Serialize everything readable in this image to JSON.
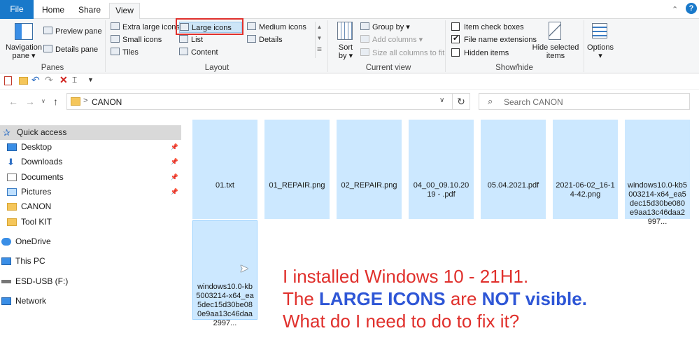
{
  "tabs": {
    "file": "File",
    "home": "Home",
    "share": "Share",
    "view": "View"
  },
  "panes": {
    "navigation_pane": "Navigation pane ▾",
    "preview_pane": "Preview pane",
    "details_pane": "Details pane",
    "group_label": "Panes"
  },
  "layout": {
    "extra_large_icons": "Extra large icons",
    "large_icons": "Large icons",
    "medium_icons": "Medium icons",
    "small_icons": "Small icons",
    "list": "List",
    "details": "Details",
    "tiles": "Tiles",
    "content": "Content",
    "group_label": "Layout"
  },
  "current_view": {
    "sort_by": "Sort by ▾",
    "group_by": "Group by ▾",
    "add_columns": "Add columns ▾",
    "size_all_columns": "Size all columns to fit",
    "group_label": "Current view"
  },
  "show_hide": {
    "item_check_boxes": "Item check boxes",
    "item_check_boxes_checked": false,
    "file_name_extensions": "File name extensions",
    "file_name_extensions_checked": true,
    "hidden_items": "Hidden items",
    "hidden_items_checked": false,
    "hide_selected_items": "Hide selected items",
    "group_label": "Show/hide"
  },
  "options": {
    "label": "Options ▾"
  },
  "address": {
    "folder": "CANON",
    "separator": ">"
  },
  "search": {
    "placeholder": "Search CANON"
  },
  "nav": [
    {
      "label": "Quick access",
      "icon": "star-icon",
      "pinned": false,
      "selected": true
    },
    {
      "label": "Desktop",
      "icon": "desktop-icon",
      "pinned": true
    },
    {
      "label": "Downloads",
      "icon": "download-icon",
      "pinned": true
    },
    {
      "label": "Documents",
      "icon": "documents-icon",
      "pinned": true
    },
    {
      "label": "Pictures",
      "icon": "pictures-icon",
      "pinned": true
    },
    {
      "label": "CANON",
      "icon": "folder-icon",
      "pinned": false
    },
    {
      "label": "Tool KIT",
      "icon": "folder-icon",
      "pinned": false
    },
    {
      "label": "OneDrive",
      "icon": "cloud-icon"
    },
    {
      "label": "This PC",
      "icon": "pc-icon"
    },
    {
      "label": "ESD-USB (F:)",
      "icon": "drive-icon"
    },
    {
      "label": "Network",
      "icon": "network-icon"
    }
  ],
  "files": [
    "01.txt",
    "01_REPAIR.png",
    "02_REPAIR.png",
    "04_00_09.10.2019 - .pdf",
    "05.04.2021.pdf",
    "2021-06-02_16-14-42.png",
    "windows10.0-kb5003214-x64_ea5dec15d30be080e9aa13c46daa2997...",
    "windows10.0-kb5003214-x64_ea5dec15d30be080e9aa13c46daa2997..."
  ],
  "annotation": {
    "line1": "I installed Windows 10 -  21H1.",
    "line2_a": "The ",
    "line2_b": "LARGE ICONS",
    "line2_c": "  are ",
    "line2_d": "NOT",
    "line2_e": " visible.",
    "line3": "What do I need to do to fix it?"
  },
  "colors": {
    "accent": "#1979ca",
    "selection": "#cce8ff",
    "highlight_box": "#e0302c",
    "note_red": "#e0302c",
    "note_blue": "#2e56d6"
  }
}
